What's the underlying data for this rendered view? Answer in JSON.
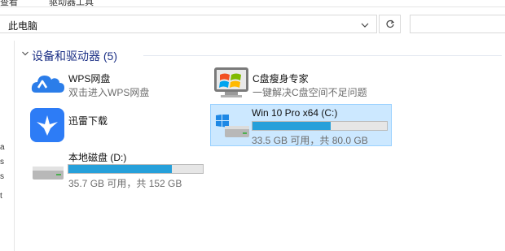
{
  "ribbon": {
    "left_text": "查看",
    "right_text": "驱动器工具"
  },
  "address": {
    "location": "此电脑"
  },
  "nav": {
    "chars": [
      "a",
      "s",
      "s",
      "t"
    ]
  },
  "group": {
    "title": "设备和驱动器 (5)"
  },
  "items": [
    {
      "name": "WPS网盘",
      "sub": "双击进入WPS网盘",
      "icon": "wps-cloud-icon"
    },
    {
      "name": "C盘瘦身专家",
      "sub": "一键解决C盘空间不足问题",
      "icon": "c-drive-cleaner-icon"
    },
    {
      "name": "迅雷下载",
      "sub": "",
      "icon": "xunlei-bird-icon"
    },
    {
      "name": "Win 10 Pro x64 (C:)",
      "sub": "33.5 GB 可用，共 80.0 GB",
      "used_fraction": 0.58,
      "icon": "windows-drive-icon"
    },
    {
      "name": "本地磁盘 (D:)",
      "sub": "35.7 GB 可用，共 152 GB",
      "used_fraction": 0.77,
      "icon": "hard-drive-icon"
    }
  ],
  "colors": {
    "accent": "#26a0da",
    "selection": "#cce8ff",
    "group_title": "#1e3287"
  }
}
